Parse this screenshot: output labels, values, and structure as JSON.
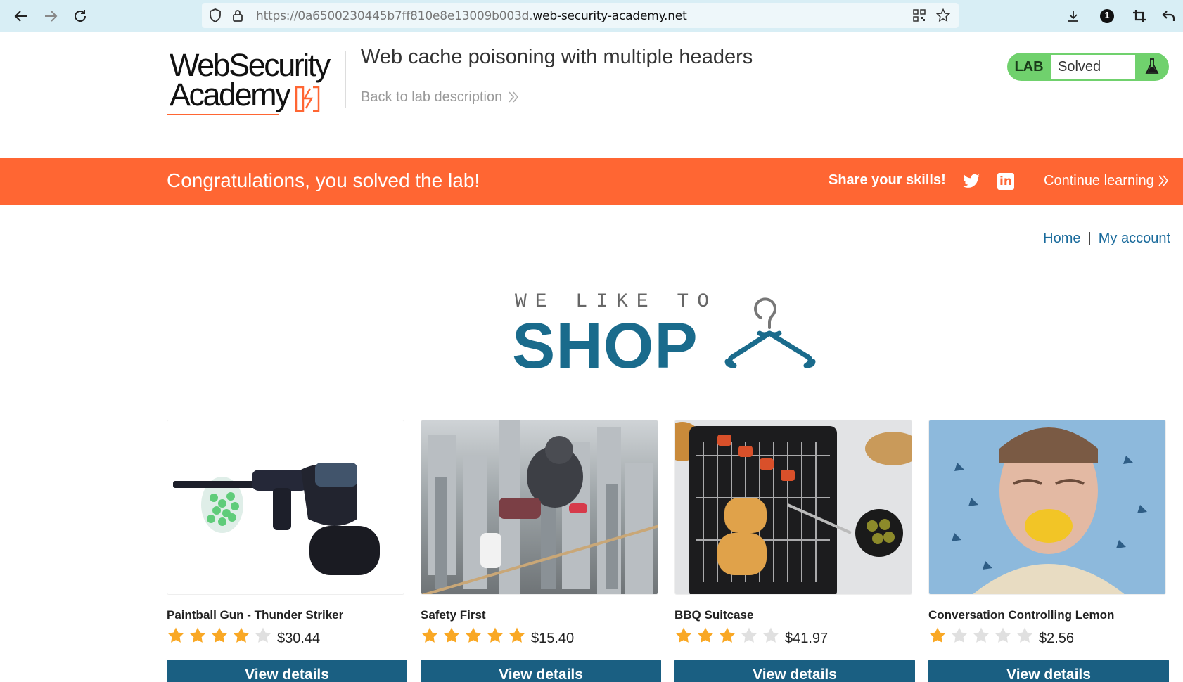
{
  "browser": {
    "url_prefix": "https://0a6500230445b7ff810e8e13009b003d.",
    "url_domain": "web-security-academy.net",
    "icons": [
      "back-arrow-icon",
      "forward-arrow-icon",
      "reload-icon",
      "shield-icon",
      "lock-icon",
      "qr-code-icon",
      "star-bookmark-icon",
      "download-icon",
      "extension-badge-icon",
      "crop-icon",
      "undo-icon"
    ],
    "extension_badge": "1"
  },
  "academy": {
    "logo_line1": "WebSecurity",
    "logo_line2": "Academy",
    "lab_title": "Web cache poisoning with multiple headers",
    "back_link": "Back to lab description",
    "badge_tag": "LAB",
    "badge_status": "Solved"
  },
  "banner": {
    "message": "Congratulations, you solved the lab!",
    "share": "Share your skills!",
    "continue": "Continue learning"
  },
  "nav": {
    "home": "Home",
    "separator": "|",
    "account": "My account"
  },
  "hero": {
    "tagline": "WE LIKE TO",
    "title": "SHOP"
  },
  "products": [
    {
      "name": "Paintball Gun - Thunder Striker",
      "rating": 4,
      "max_rating": 5,
      "price": "$30.44",
      "button": "View details"
    },
    {
      "name": "Safety First",
      "rating": 5,
      "max_rating": 5,
      "price": "$15.40",
      "button": "View details"
    },
    {
      "name": "BBQ Suitcase",
      "rating": 3,
      "max_rating": 5,
      "price": "$41.97",
      "button": "View details"
    },
    {
      "name": "Conversation Controlling Lemon",
      "rating": 1,
      "max_rating": 5,
      "price": "$2.56",
      "button": "View details"
    }
  ],
  "colors": {
    "banner": "#ff6633",
    "link": "#1a6b9c",
    "button": "#1a5f82",
    "solved": "#70d16d",
    "star_on": "#f9a825",
    "star_off": "#e0e0e0"
  }
}
